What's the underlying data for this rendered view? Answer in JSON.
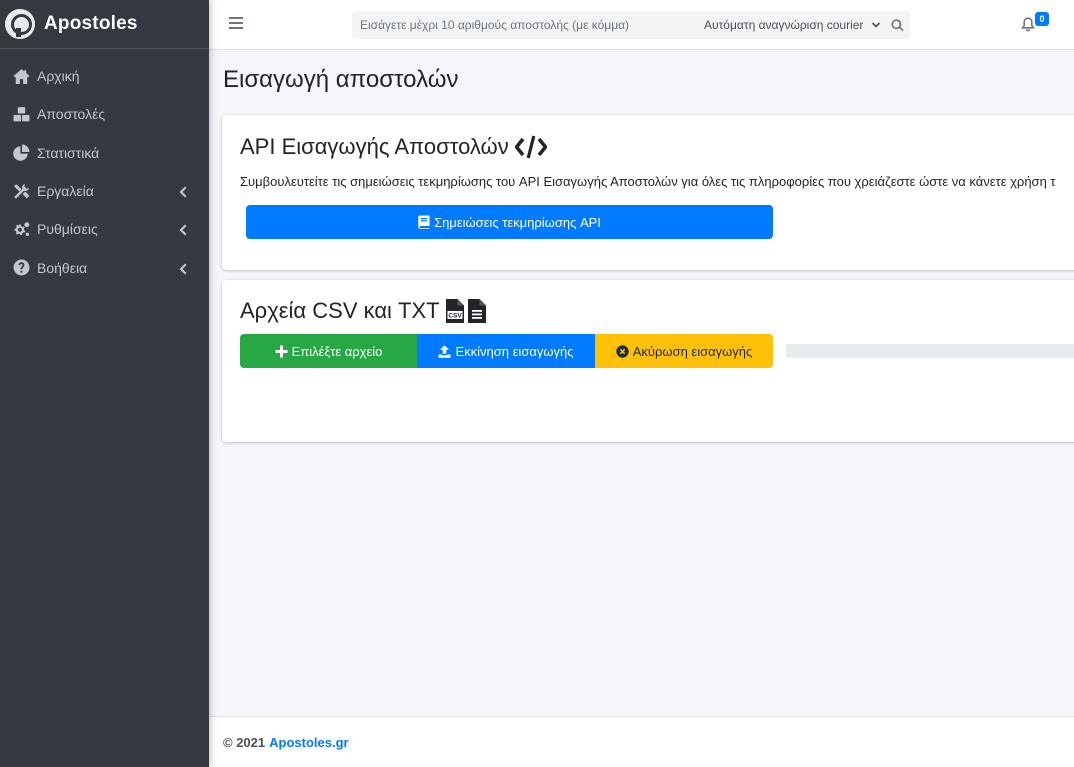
{
  "brand": {
    "name": "Apostoles"
  },
  "sidebar": {
    "items": [
      {
        "label": "Αρχική",
        "icon": "home-icon",
        "has_submenu": false
      },
      {
        "label": "Αποστολές",
        "icon": "boxes-icon",
        "has_submenu": true
      },
      {
        "label": "Στατιστικά",
        "icon": "pie-chart-icon",
        "has_submenu": false
      },
      {
        "label": "Εργαλεία",
        "icon": "tools-icon",
        "has_submenu": true
      },
      {
        "label": "Ρυθμίσεις",
        "icon": "cogs-icon",
        "has_submenu": true
      },
      {
        "label": "Βοήθεια",
        "icon": "question-circle-icon",
        "has_submenu": true
      }
    ]
  },
  "topbar": {
    "search_placeholder": "Εισάγετε μέχρι 10 αριθμούς αποστολής (με κόμμα)",
    "courier_selected": "Αυτόματη αναγνώριση courier",
    "notifications_count": "0"
  },
  "main": {
    "page_title": "Εισαγωγή αποστολών",
    "api_card": {
      "title": "API Εισαγωγής Αποστολών",
      "description": "Συμβουλευτείτε τις σημειώσεις τεκμηρίωσης του API Εισαγωγής Αποστολών για όλες τις πληροφορίες που χρειάζεστε ώστε να κάνετε χρήση τ",
      "doc_button": "Σημειώσεις τεκμηρίωσης API"
    },
    "files_card": {
      "title": "Αρχεία CSV και TXT",
      "choose_button": "Επιλέξτε αρχείο",
      "start_button": "Εκκίνηση εισαγωγής",
      "cancel_button": "Ακύρωση εισαγωγής",
      "progress": 0
    }
  },
  "footer": {
    "copyright": "© 2021",
    "site": "Apostoles.gr"
  },
  "colors": {
    "sidebar": "#343a40",
    "primary": "#007bff",
    "success": "#28a745",
    "warning": "#ffc107"
  }
}
